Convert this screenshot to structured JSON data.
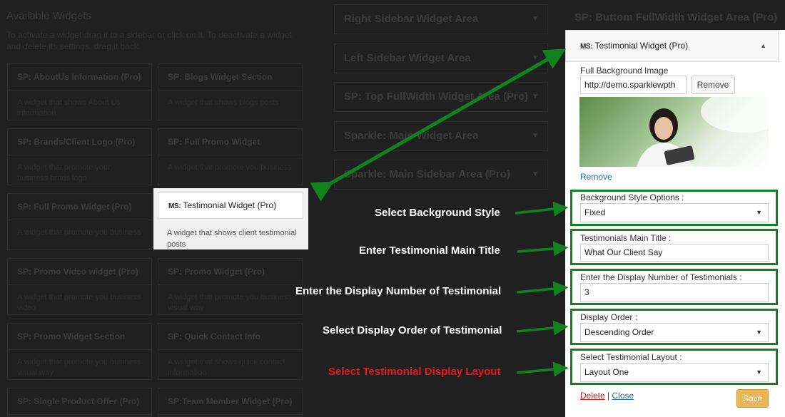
{
  "available": {
    "title": "Available Widgets",
    "description": "To activate a widget drag it to a sidebar or click on it. To deactivate a widget and delete its settings, drag it back.",
    "widgets": [
      {
        "title": "SP: AboutUs Information (Pro)",
        "desc": "A widget that shows About Us information"
      },
      {
        "title": "SP: Blogs Widget Section",
        "desc": "A widget that shows blogs posts"
      },
      {
        "title": "SP: Brands/Client Logo (Pro)",
        "desc": "A widget that promote your business brnds logo"
      },
      {
        "title": "SP: Full Promo Widget",
        "desc": "A widget that promote you business"
      },
      {
        "title": "SP: Full Promo Widget (Pro)",
        "desc": "A widget that promote you business"
      },
      {
        "title": "",
        "desc": ""
      },
      {
        "title": "SP: Promo Video widget (Pro)",
        "desc": "A widget that promote you business video"
      },
      {
        "title": "SP: Promo Widget (Pro)",
        "desc": "A widget that promote you business visual way"
      },
      {
        "title": "SP: Promo Widget Section",
        "desc": "A widget that promote you business visual way"
      },
      {
        "title": "SP: Quick Contact Info",
        "desc": "A widget that shows quick contact information"
      },
      {
        "title": "SP: Single Product Offer (Pro)",
        "desc": ""
      },
      {
        "title": "SP:Team Member Widget (Pro)",
        "desc": ""
      }
    ]
  },
  "areas": [
    "Right Sidebar Widget Area",
    "Left Sidebar Widget Area",
    "SP: Top FullWidth Widget Area (Pro)",
    "Sparkle: Main Widget Area",
    "Sparkle: Main Sidebar Area (Pro)"
  ],
  "bottom_area_title": "SP: Buttom FullWidth Widget Area (Pro)",
  "dragged_widget": {
    "prefix": "MS:",
    "title": "Testimonial Widget (Pro)",
    "desc": "A widget that shows client testimonial posts"
  },
  "panel": {
    "prefix": "MS:",
    "title": "Testimonial Widget (Pro)",
    "bg_image_label": "Full Background Image",
    "bg_image_url": "http://demo.sparklewpth",
    "remove_button": "Remove",
    "remove_link": "Remove",
    "bg_style_label": "Background Style Options :",
    "bg_style_value": "Fixed",
    "main_title_label": "Testimonials Main Title :",
    "main_title_value": "What Our Client Say",
    "display_number_label": "Enter the Display Number of Testimonials :",
    "display_number_value": "3",
    "display_order_label": "Display Order :",
    "display_order_value": "Descending Order",
    "layout_label": "Select Testimonial Layout :",
    "layout_value": "Layout One",
    "delete_link": "Delete",
    "separator": "|",
    "close_link": "Close",
    "save_button": "Save"
  },
  "annotations": {
    "bg_style": "Select Background Style",
    "main_title": "Enter Testimonial Main Title",
    "display_number": "Enter the Display Number of Testimonial",
    "display_order": "Select Display Order of Testimonial",
    "layout": "Select Testimonial Display Layout"
  },
  "colors": {
    "arrow_green": "#12821e",
    "annotation_red": "#e8191b",
    "save_button": "#e9b75a",
    "link_blue": "#1f6fb2"
  }
}
